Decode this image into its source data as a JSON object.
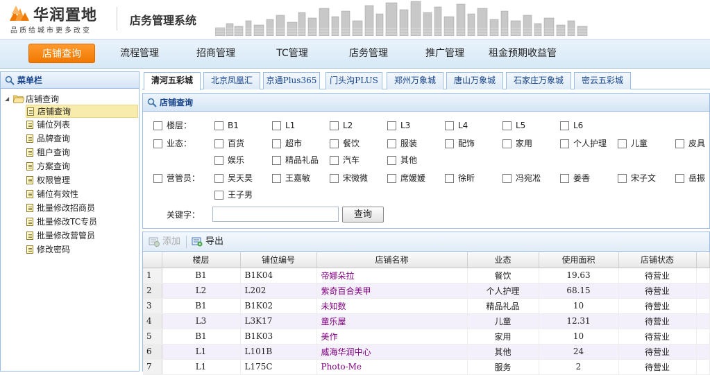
{
  "brand": {
    "name": "华润置地",
    "slogan": "品质给城市更多改变",
    "system_title": "店务管理系统"
  },
  "topnav": [
    {
      "label": "店铺查询",
      "active": true
    },
    {
      "label": "流程管理"
    },
    {
      "label": "招商管理"
    },
    {
      "label": "TC管理"
    },
    {
      "label": "店务管理"
    },
    {
      "label": "推广管理"
    },
    {
      "label": "租金预期收益管"
    }
  ],
  "sidebar": {
    "title": "菜单栏",
    "root": "店铺查询",
    "items": [
      {
        "label": "店铺查询",
        "selected": true
      },
      {
        "label": "铺位列表"
      },
      {
        "label": "品牌查询"
      },
      {
        "label": "租户查询"
      },
      {
        "label": "方案查询"
      },
      {
        "label": "权限管理"
      },
      {
        "label": "铺位有效性"
      },
      {
        "label": "批量修改招商员"
      },
      {
        "label": "批量修改TC专员"
      },
      {
        "label": "批量修改营管员"
      },
      {
        "label": "修改密码"
      }
    ]
  },
  "tabs": [
    {
      "label": "清河五彩城",
      "active": true
    },
    {
      "label": "北京凤凰汇"
    },
    {
      "label": "京通Plus365"
    },
    {
      "label": "门头沟PLUS"
    },
    {
      "label": "郑州万象城"
    },
    {
      "label": "唐山万象城"
    },
    {
      "label": "石家庄万象城"
    },
    {
      "label": "密云五彩城"
    }
  ],
  "query": {
    "title": "店铺查询",
    "floor": {
      "label": "楼层：",
      "options": [
        "B1",
        "L1",
        "L2",
        "L3",
        "L4",
        "L5",
        "L6"
      ]
    },
    "format": {
      "label": "业态：",
      "options": [
        "百货",
        "超市",
        "餐饮",
        "服装",
        "配饰",
        "家用",
        "个人护理",
        "儿童",
        "皮具",
        "娱乐",
        "精品礼品",
        "汽车",
        "其他"
      ]
    },
    "manager": {
      "label": "营管员：",
      "options": [
        "吴天昊",
        "王嘉敏",
        "宋微微",
        "席媛媛",
        "徐昕",
        "冯宛凇",
        "姜香",
        "宋子文",
        "岳振",
        "王子男"
      ]
    },
    "keyword_label": "关键字：",
    "keyword_value": "",
    "search_button": "查询"
  },
  "toolbar": {
    "add_label": "添加",
    "export_label": "导出"
  },
  "table": {
    "columns": [
      "",
      "楼层",
      "铺位编号",
      "店铺名称",
      "业态",
      "使用面积",
      "店铺状态"
    ],
    "rows": [
      {
        "n": "1",
        "floor": "B1",
        "unit": "B1K04",
        "name": "帝娜朵拉",
        "format": "餐饮",
        "area": "19.63",
        "status": "待营业"
      },
      {
        "n": "2",
        "floor": "L2",
        "unit": "L202",
        "name": "紫奇百合美甲",
        "format": "个人护理",
        "area": "68.15",
        "status": "待营业"
      },
      {
        "n": "3",
        "floor": "B1",
        "unit": "B1K02",
        "name": "未知数",
        "format": "精品礼品",
        "area": "10",
        "status": "待营业"
      },
      {
        "n": "4",
        "floor": "L3",
        "unit": "L3K17",
        "name": "童乐屋",
        "format": "儿童",
        "area": "12.31",
        "status": "待营业"
      },
      {
        "n": "5",
        "floor": "B1",
        "unit": "B1K03",
        "name": "美作",
        "format": "家用",
        "area": "10",
        "status": "待营业"
      },
      {
        "n": "6",
        "floor": "L1",
        "unit": "L101B",
        "name": "威海华润中心",
        "format": "其他",
        "area": "24",
        "status": "待营业"
      },
      {
        "n": "7",
        "floor": "L1",
        "unit": "L175C",
        "name": "Photo-Me",
        "format": "服务",
        "area": "2",
        "status": "待营业"
      }
    ]
  },
  "colors": {
    "accent": "#f07800",
    "link": "#800080",
    "panel_border": "#99bbe8",
    "header_text": "#15428b"
  }
}
